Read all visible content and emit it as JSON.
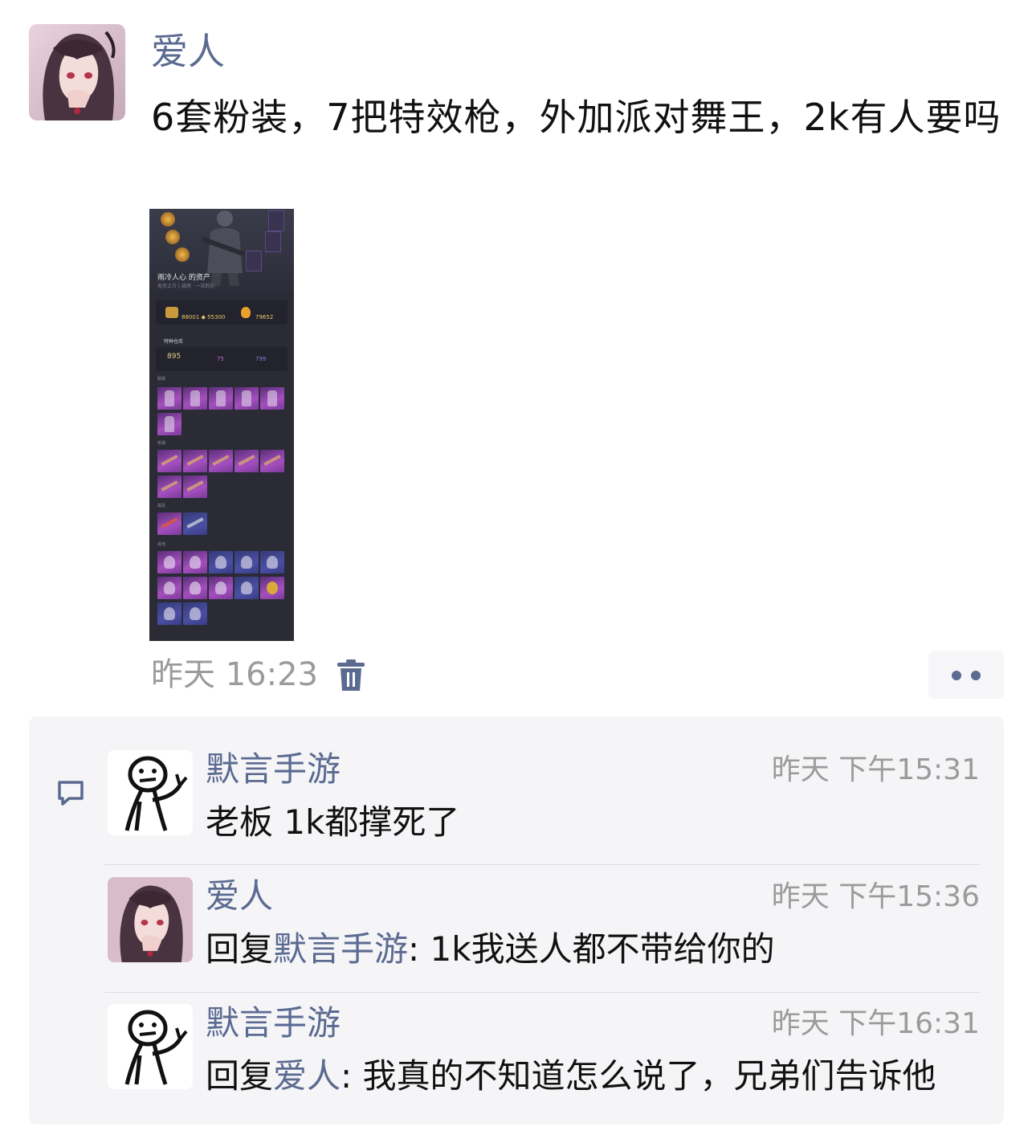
{
  "post": {
    "author": "爱人",
    "text": "6套粉装，7把特效枪，外加派对舞王，2k有人要吗",
    "time": "昨天 16:23",
    "image": {
      "title": "雨冷人心 的资产",
      "subtitle": "无尽上方 | 战场 · 一次的心",
      "stat_a": "88001  ◆ 55300",
      "stat_b": "79652",
      "section": "特种仓库",
      "count_main": "895",
      "count_mid": "75",
      "count_right": "799",
      "label_outfits": "服装",
      "label_guns": "枪械",
      "label_vehicles": "载具",
      "label_other": "其他"
    }
  },
  "comments": [
    {
      "author": "默言手游",
      "time": "昨天  下午15:31",
      "text": "老板 1k都撑死了",
      "avatar": "stick-figure"
    },
    {
      "author": "爱人",
      "time": "昨天  下午15:36",
      "reply_prefix": "回复",
      "reply_to": "默言手游",
      "text": ": 1k我送人都不带给你的",
      "avatar": "anime-girl"
    },
    {
      "author": "默言手游",
      "time": "昨天  下午16:31",
      "reply_prefix": "回复",
      "reply_to": "爱人",
      "text": ": 我真的不知道怎么说了，兄弟们告诉他",
      "avatar": "stick-figure"
    }
  ],
  "colors": {
    "name_blue": "#5b6a91",
    "meta_gray": "#9b9b9b",
    "comment_bg": "#f5f5f7"
  },
  "icons": {
    "delete": "trash-icon",
    "more": "more-dots-icon",
    "comment": "comment-bubble-icon"
  }
}
